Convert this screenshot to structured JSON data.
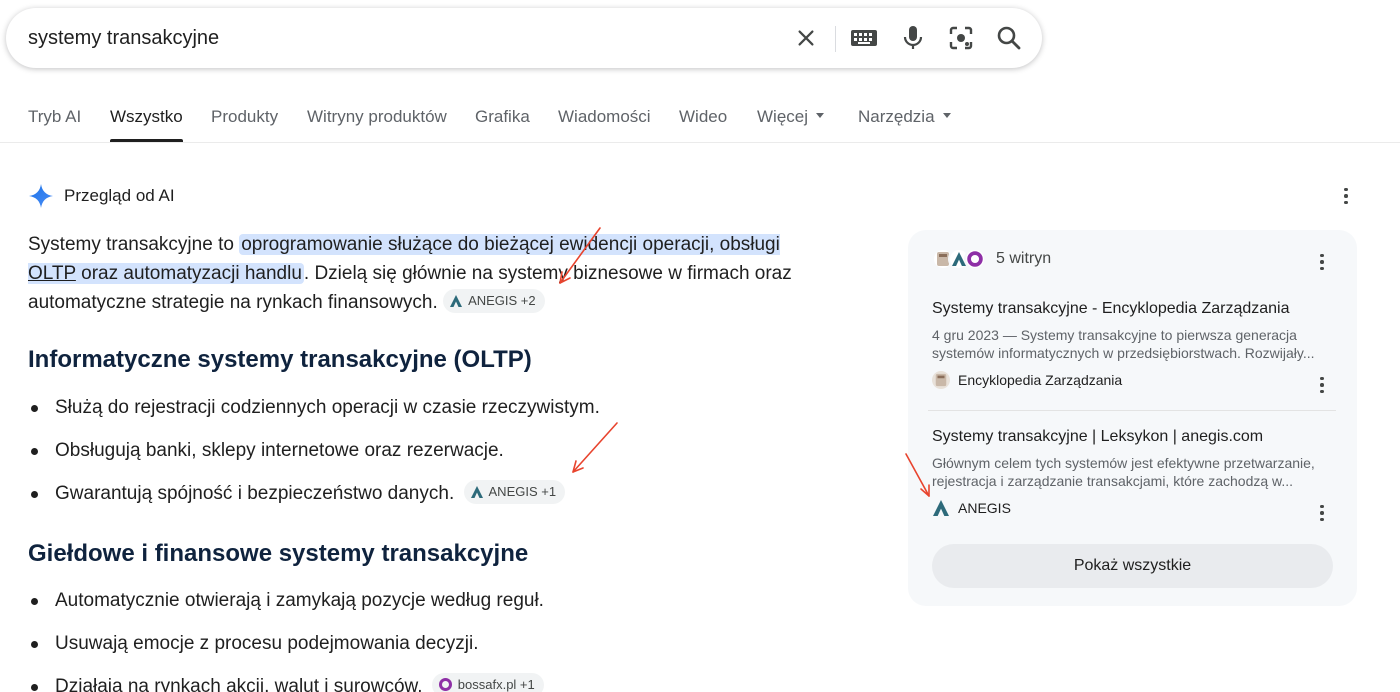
{
  "search": {
    "query": "systemy transakcyjne",
    "clear_icon": "close-icon",
    "keyboard_icon": "keyboard-icon",
    "mic_icon": "mic-icon",
    "lens_icon": "camera-lens-icon",
    "search_icon": "search-icon"
  },
  "tabs": [
    {
      "label": "Tryb AI"
    },
    {
      "label": "Wszystko",
      "active": true
    },
    {
      "label": "Produkty"
    },
    {
      "label": "Witryny produktów"
    },
    {
      "label": "Grafika"
    },
    {
      "label": "Wiadomości"
    },
    {
      "label": "Wideo"
    },
    {
      "label": "Więcej"
    },
    {
      "label": "Narzędzia"
    }
  ],
  "ai_overview": {
    "title": "Przegląd od AI",
    "intro": {
      "part1": "Systemy transakcyjne to ",
      "highlight1": "oprogramowanie służące do bieżącej ewidencji operacji, obsługi",
      "highlight_link": "OLTP",
      "highlight2": " oraz automatyzacji handlu",
      "part2": ". Dzielą się głównie na systemy biznesowe w firmach oraz automatyczne strategie na rynkach finansowych.",
      "chip": "ANEGIS +2"
    },
    "section1": {
      "heading": "Informatyczne systemy transakcyjne (OLTP)",
      "items": [
        "Służą do rejestracji codziennych operacji w czasie rzeczywistym.",
        "Obsługują banki, sklepy internetowe oraz rezerwacje.",
        "Gwarantują spójność i bezpieczeństwo danych."
      ],
      "chip": "ANEGIS +1"
    },
    "section2": {
      "heading": "Giełdowe i finansowe systemy transakcyjne",
      "items": [
        "Automatycznie otwierają i zamykają pozycje według reguł.",
        "Usuwają emocje z procesu podejmowania decyzji.",
        "Działają na rynkach akcji, walut i surowców."
      ],
      "chip": "bossafx.pl +1"
    }
  },
  "sources_panel": {
    "count": "5 witryn",
    "sources": [
      {
        "title": "Systemy transakcyjne - Encyklopedia Zarządzania",
        "snippet": "4 gru 2023 — Systemy transakcyjne to pierwsza generacja systemów informatycznych w przedsiębiorstwach. Rozwijały...",
        "site": "Encyklopedia Zarządzania"
      },
      {
        "title": "Systemy transakcyjne | Leksykon | anegis.com",
        "snippet": "Głównym celem tych systemów jest efektywne przetwarzanie, rejestracja i zarządzanie transakcjami, które zachodzą w...",
        "site": "ANEGIS"
      }
    ],
    "show_all": "Pokaż wszystkie"
  },
  "colors": {
    "highlight": "#d3e3fd",
    "heading": "#0f233e",
    "anegis": "#2d6a7a",
    "bossa": "#8e2fa6",
    "arrow": "#e8442e"
  }
}
